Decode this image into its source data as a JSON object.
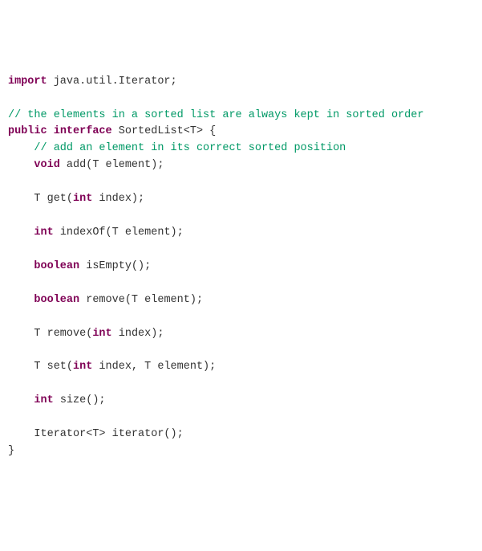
{
  "code": {
    "lines": [
      {
        "parts": [
          {
            "cls": "kw",
            "t": "import"
          },
          {
            "cls": "normal",
            "t": " java.util.Iterator;"
          }
        ]
      },
      {
        "parts": [
          {
            "cls": "normal",
            "t": ""
          }
        ]
      },
      {
        "parts": [
          {
            "cls": "comment",
            "t": "// the elements in a sorted list are always kept in sorted order"
          }
        ]
      },
      {
        "parts": [
          {
            "cls": "kw",
            "t": "public"
          },
          {
            "cls": "normal",
            "t": " "
          },
          {
            "cls": "kw",
            "t": "interface"
          },
          {
            "cls": "normal",
            "t": " SortedList<T> {"
          }
        ]
      },
      {
        "parts": [
          {
            "cls": "normal",
            "t": "    "
          },
          {
            "cls": "comment",
            "t": "// add an element in its correct sorted position"
          }
        ]
      },
      {
        "parts": [
          {
            "cls": "normal",
            "t": "    "
          },
          {
            "cls": "kw",
            "t": "void"
          },
          {
            "cls": "normal",
            "t": " add(T element);"
          }
        ]
      },
      {
        "parts": [
          {
            "cls": "normal",
            "t": ""
          }
        ]
      },
      {
        "parts": [
          {
            "cls": "normal",
            "t": "    T get("
          },
          {
            "cls": "kw",
            "t": "int"
          },
          {
            "cls": "normal",
            "t": " index);"
          }
        ]
      },
      {
        "parts": [
          {
            "cls": "normal",
            "t": ""
          }
        ]
      },
      {
        "parts": [
          {
            "cls": "normal",
            "t": "    "
          },
          {
            "cls": "kw",
            "t": "int"
          },
          {
            "cls": "normal",
            "t": " indexOf(T element);"
          }
        ]
      },
      {
        "parts": [
          {
            "cls": "normal",
            "t": ""
          }
        ]
      },
      {
        "parts": [
          {
            "cls": "normal",
            "t": "    "
          },
          {
            "cls": "kw",
            "t": "boolean"
          },
          {
            "cls": "normal",
            "t": " isEmpty();"
          }
        ]
      },
      {
        "parts": [
          {
            "cls": "normal",
            "t": ""
          }
        ]
      },
      {
        "parts": [
          {
            "cls": "normal",
            "t": "    "
          },
          {
            "cls": "kw",
            "t": "boolean"
          },
          {
            "cls": "normal",
            "t": " remove(T element);"
          }
        ]
      },
      {
        "parts": [
          {
            "cls": "normal",
            "t": ""
          }
        ]
      },
      {
        "parts": [
          {
            "cls": "normal",
            "t": "    T remove("
          },
          {
            "cls": "kw",
            "t": "int"
          },
          {
            "cls": "normal",
            "t": " index);"
          }
        ]
      },
      {
        "parts": [
          {
            "cls": "normal",
            "t": ""
          }
        ]
      },
      {
        "parts": [
          {
            "cls": "normal",
            "t": "    T set("
          },
          {
            "cls": "kw",
            "t": "int"
          },
          {
            "cls": "normal",
            "t": " index, T element);"
          }
        ]
      },
      {
        "parts": [
          {
            "cls": "normal",
            "t": ""
          }
        ]
      },
      {
        "parts": [
          {
            "cls": "normal",
            "t": "    "
          },
          {
            "cls": "kw",
            "t": "int"
          },
          {
            "cls": "normal",
            "t": " size();"
          }
        ]
      },
      {
        "parts": [
          {
            "cls": "normal",
            "t": ""
          }
        ]
      },
      {
        "parts": [
          {
            "cls": "normal",
            "t": "    Iterator<T> iterator();"
          }
        ]
      },
      {
        "parts": [
          {
            "cls": "normal",
            "t": "}"
          }
        ]
      }
    ]
  }
}
